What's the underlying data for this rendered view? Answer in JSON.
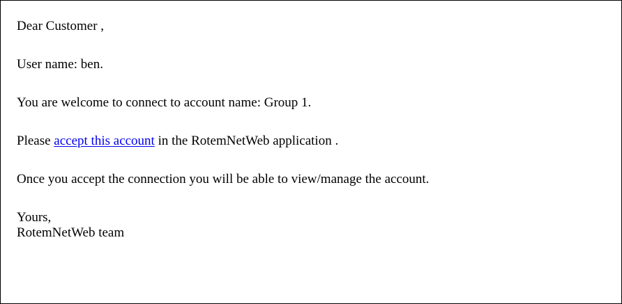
{
  "email": {
    "greeting": "Dear Customer ,",
    "username_line": "User name: ben.",
    "welcome_line": "You are welcome to connect to account name: Group 1.",
    "accept": {
      "prefix": "Please ",
      "link_text": "accept this account",
      "suffix": " in the RotemNetWeb application ."
    },
    "once_line": "Once you accept the connection you will be able to view/manage the account.",
    "signature": {
      "closing": "Yours,",
      "team": "RotemNetWeb team"
    }
  },
  "colors": {
    "link": "#0000ee",
    "border": "#000000",
    "text": "#000000",
    "background": "#ffffff"
  }
}
